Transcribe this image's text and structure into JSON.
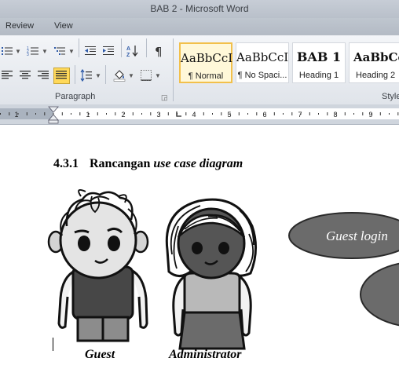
{
  "window": {
    "title": "BAB 2  -  Microsoft Word"
  },
  "ribbon_tabs": [
    {
      "label": "Review"
    },
    {
      "label": "View"
    }
  ],
  "ribbon": {
    "paragraph_group_label": "Paragraph",
    "styles_group_label": "Style",
    "styles": [
      {
        "sample": "AaBbCcI",
        "name": "¶ Normal",
        "selected": true
      },
      {
        "sample": "AaBbCcI",
        "name": "¶ No Spaci...",
        "selected": false
      },
      {
        "sample": "BAB 1",
        "name": "Heading 1",
        "selected": false
      },
      {
        "sample": "AaBbCc",
        "name": "Heading 2",
        "selected": false
      }
    ],
    "buttons": {
      "bullets": "bullets-icon",
      "numbering": "numbering-icon",
      "multilevel": "multilevel-list-icon",
      "decrease_indent": "decrease-indent-icon",
      "increase_indent": "increase-indent-icon",
      "sort": "sort-az-icon",
      "show_marks": "pilcrow-icon",
      "align_left": "align-left-icon",
      "center": "align-center-icon",
      "align_right": "align-right-icon",
      "justify": "justify-icon",
      "line_spacing": "line-spacing-icon",
      "shading": "paint-bucket-icon",
      "borders": "borders-icon"
    },
    "active_button": "justify",
    "accent_color": "#ffd95a"
  },
  "ruler": {
    "numbers": [
      "1",
      "1",
      "2",
      "3",
      "4",
      "5",
      "6",
      "7",
      "8",
      "9"
    ]
  },
  "document": {
    "heading_number": "4.3.1",
    "heading_text": "Rancangan ",
    "heading_italic": "use case diagram",
    "actors": [
      {
        "label": "Guest"
      },
      {
        "label": "Administrator"
      }
    ],
    "use_cases": [
      {
        "label": "Guest login"
      }
    ],
    "use_case_color": "#6b6b6b"
  }
}
